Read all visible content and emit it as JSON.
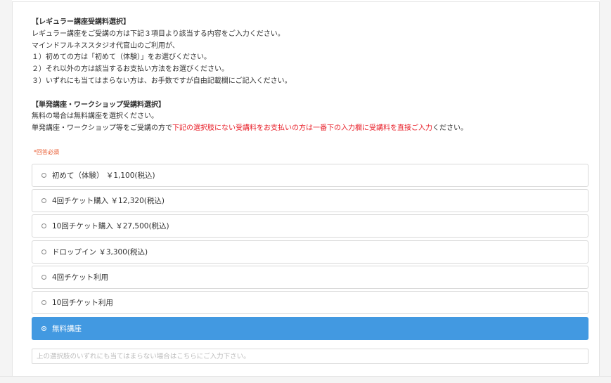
{
  "description": {
    "regular_heading": "【レギュラー講座受講料選択】",
    "regular_line1": "レギュラー講座をご受講の方は下記３項目より該当する内容をご入力ください。",
    "regular_line2": "マインドフルネススタジオ代官山のご利用が、",
    "regular_item1": "１）初めての方は「初めて（体験）」をお選びください。",
    "regular_item2": "２）それ以外の方は該当するお支払い方法をお選びください。",
    "regular_item3": "３）いずれにも当てはまらない方は、お手数ですが自由記載欄にご記入ください。",
    "single_heading": "【単発講座・ワークショップ受講料選択】",
    "single_line1": "無料の場合は無料講座を選択ください。",
    "single_line2_pre": "単発講座・ワークショップ等をご受講の方で",
    "single_line2_red": "下記の選択肢にない受講料をお支払いの方は一番下の入力欄に受講料を直接ご入力",
    "single_line2_post": "ください。"
  },
  "required_label": "*回答必須",
  "options": [
    {
      "label": "初めて（体験） ￥1,100(税込)",
      "selected": false
    },
    {
      "label": "4回チケット購入 ￥12,320(税込)",
      "selected": false
    },
    {
      "label": "10回チケット購入 ￥27,500(税込)",
      "selected": false
    },
    {
      "label": "ドロップイン ￥3,300(税込)",
      "selected": false
    },
    {
      "label": "4回チケット利用",
      "selected": false
    },
    {
      "label": "10回チケット利用",
      "selected": false
    },
    {
      "label": "無料講座",
      "selected": true
    }
  ],
  "free_input": {
    "placeholder": "上の選択肢のいずれにも当てはまらない場合はこちらにご入力下さい。",
    "value": ""
  },
  "colors": {
    "selected_bg": "#4299e1",
    "highlight_text": "#e8202a",
    "required_text": "#e8562a"
  }
}
